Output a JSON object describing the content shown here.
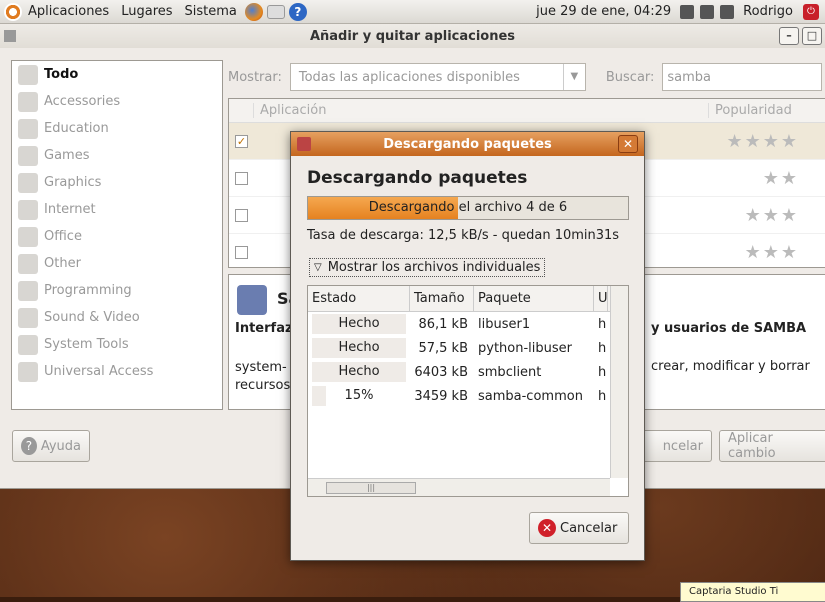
{
  "panel": {
    "menus": [
      "Aplicaciones",
      "Lugares",
      "Sistema"
    ],
    "clock": "jue 29 de ene, 04:29",
    "user": "Rodrigo"
  },
  "window": {
    "title": "Añadir y quitar aplicaciones"
  },
  "sidebar": {
    "items": [
      {
        "label": "Todo",
        "icon": "all-icon"
      },
      {
        "label": "Accessories",
        "icon": "accessories-icon"
      },
      {
        "label": "Education",
        "icon": "education-icon"
      },
      {
        "label": "Games",
        "icon": "games-icon"
      },
      {
        "label": "Graphics",
        "icon": "graphics-icon"
      },
      {
        "label": "Internet",
        "icon": "internet-icon"
      },
      {
        "label": "Office",
        "icon": "office-icon"
      },
      {
        "label": "Other",
        "icon": "other-icon"
      },
      {
        "label": "Programming",
        "icon": "programming-icon"
      },
      {
        "label": "Sound & Video",
        "icon": "sound-video-icon"
      },
      {
        "label": "System Tools",
        "icon": "system-tools-icon"
      },
      {
        "label": "Universal Access",
        "icon": "universal-access-icon"
      }
    ]
  },
  "filter": {
    "show_label": "Mostrar:",
    "show_value": "Todas las aplicaciones disponibles",
    "search_label": "Buscar:",
    "search_value": "samba"
  },
  "app_list": {
    "col_app": "Aplicación",
    "col_pop": "Popularidad",
    "rows": [
      {
        "checked": true,
        "stars": "★★★★"
      },
      {
        "checked": false,
        "stars": "★★"
      },
      {
        "checked": false,
        "stars": "★★★"
      },
      {
        "checked": false,
        "stars": "★★★"
      }
    ]
  },
  "description": {
    "title_partial": "Sa",
    "subtitle_left": "Interfaz",
    "subtitle_right": "y usuarios de SAMBA",
    "text_left_1": "system-",
    "text_left_2": "recursos",
    "text_right": "crear, modificar y borrar"
  },
  "buttons": {
    "help": "Ayuda",
    "cancel_partial": "ncelar",
    "apply_partial": "Aplicar cambio"
  },
  "dialog": {
    "title": "Descargando paquetes",
    "heading": "Descargando paquetes",
    "progress_text": "Descargando el archivo 4 de 6",
    "progress_fraction": 0.47,
    "rate": "Tasa de descarga: 12,5 kB/s - quedan 10min31s",
    "expander": "Mostrar los archivos individuales",
    "columns": [
      "Estado",
      "Tamaño",
      "Paquete",
      "U"
    ],
    "files": [
      {
        "estado": "Hecho",
        "tamano": "86,1 kB",
        "paquete": "libuser1",
        "u": "h"
      },
      {
        "estado": "Hecho",
        "tamano": "57,5 kB",
        "paquete": "python-libuser",
        "u": "h"
      },
      {
        "estado": "Hecho",
        "tamano": "6403 kB",
        "paquete": "smbclient",
        "u": "h"
      },
      {
        "estado": "15%",
        "tamano": "3459 kB",
        "paquete": "samba-common",
        "u": "h"
      }
    ],
    "cancel": "Cancelar"
  },
  "tooltip": "Captaria Studio Ti"
}
